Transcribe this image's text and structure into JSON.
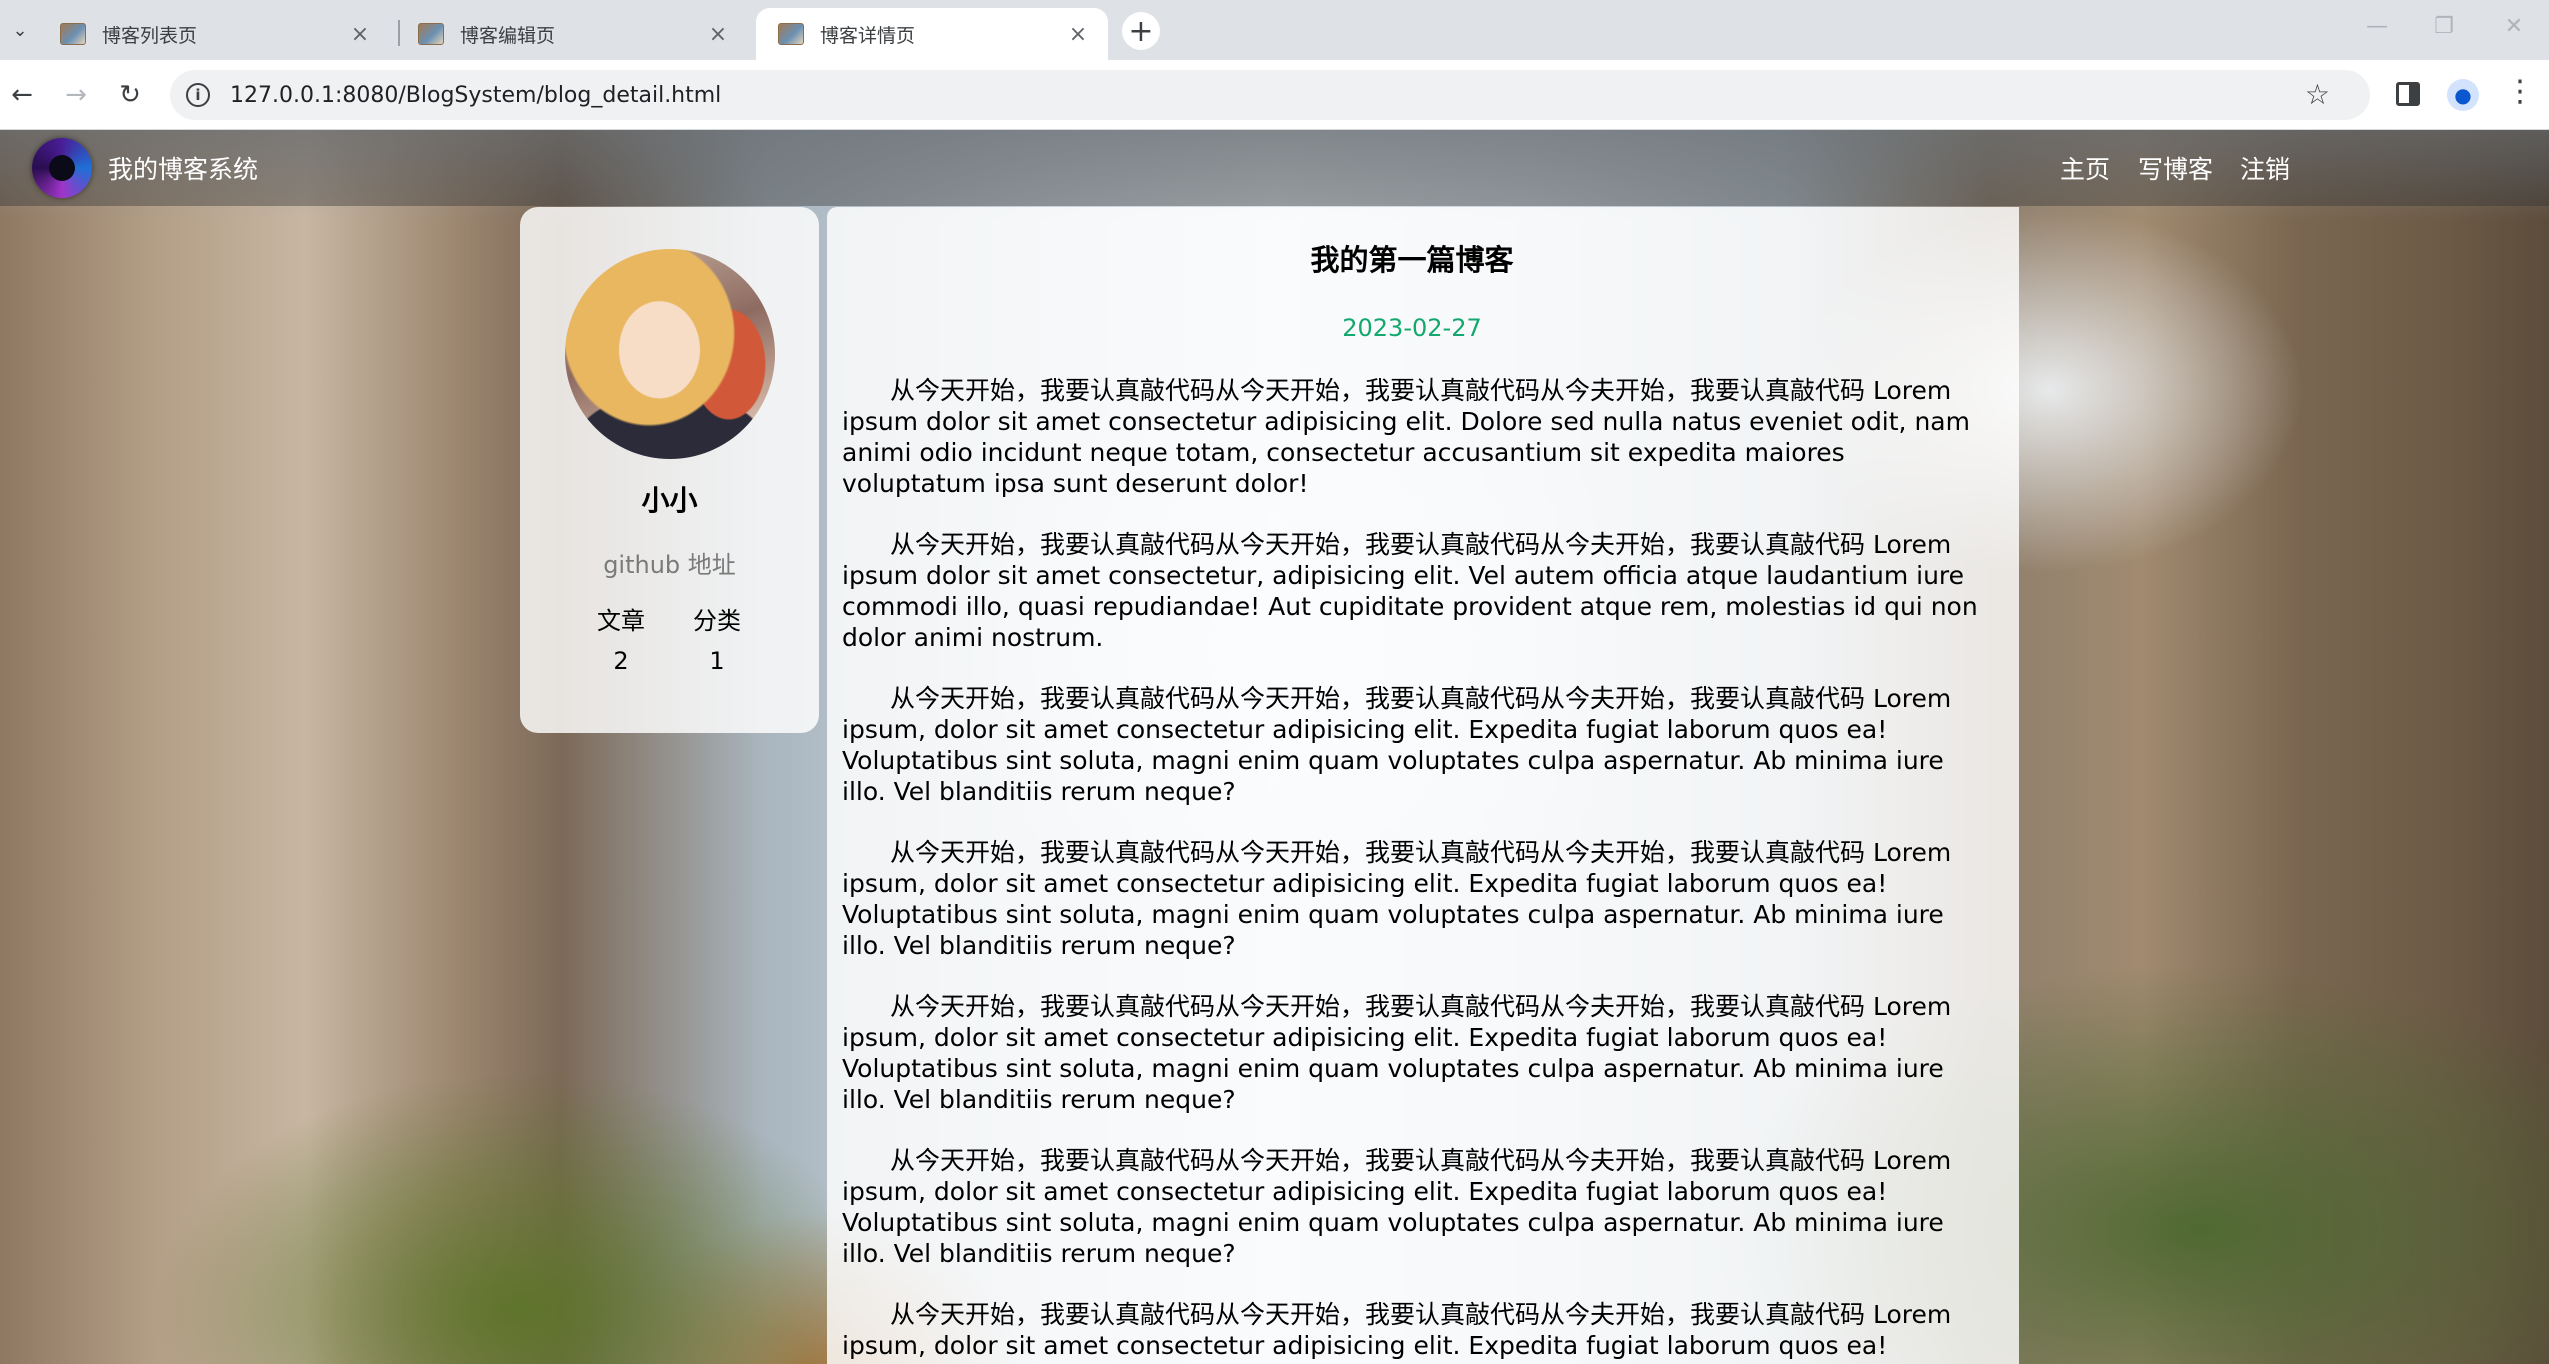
{
  "browser": {
    "tabs": [
      {
        "title": "博客列表页",
        "active": false
      },
      {
        "title": "博客编辑页",
        "active": false
      },
      {
        "title": "博客详情页",
        "active": true
      }
    ],
    "url": "127.0.0.1:8080/BlogSystem/blog_detail.html"
  },
  "site": {
    "title": "我的博客系统",
    "nav": {
      "home": "主页",
      "write": "写博客",
      "logout": "注销"
    }
  },
  "profile": {
    "name": "小小",
    "github": "github 地址",
    "stats": {
      "articles_label": "文章",
      "categories_label": "分类",
      "articles_value": "2",
      "categories_value": "1"
    }
  },
  "article": {
    "title": "我的第一篇博客",
    "date": "2023-02-27",
    "paragraphs": [
      "从今天开始，我要认真敲代码从今天开始，我要认真敲代码从今夫开始，我要认真敲代码 Lorem ipsum dolor sit amet consectetur adipisicing elit. Dolore sed nulla natus eveniet odit, nam animi odio incidunt neque totam, consectetur accusantium sit expedita maiores voluptatum ipsa sunt deserunt dolor!",
      "从今天开始，我要认真敲代码从今天开始，我要认真敲代码从今夫开始，我要认真敲代码 Lorem ipsum dolor sit amet consectetur, adipisicing elit. Vel autem officia atque laudantium iure commodi illo, quasi repudiandae! Aut cupiditate provident atque rem, molestias id qui non dolor animi nostrum.",
      "从今天开始，我要认真敲代码从今天开始，我要认真敲代码从今夫开始，我要认真敲代码 Lorem ipsum, dolor sit amet consectetur adipisicing elit. Expedita fugiat laborum quos ea! Voluptatibus sint soluta, magni enim quam voluptates culpa aspernatur. Ab minima iure illo. Vel blanditiis rerum neque?",
      "从今天开始，我要认真敲代码从今天开始，我要认真敲代码从今夫开始，我要认真敲代码 Lorem ipsum, dolor sit amet consectetur adipisicing elit. Expedita fugiat laborum quos ea! Voluptatibus sint soluta, magni enim quam voluptates culpa aspernatur. Ab minima iure illo. Vel blanditiis rerum neque?",
      "从今天开始，我要认真敲代码从今天开始，我要认真敲代码从今夫开始，我要认真敲代码 Lorem ipsum, dolor sit amet consectetur adipisicing elit. Expedita fugiat laborum quos ea! Voluptatibus sint soluta, magni enim quam voluptates culpa aspernatur. Ab minima iure illo. Vel blanditiis rerum neque?",
      "从今天开始，我要认真敲代码从今天开始，我要认真敲代码从今夫开始，我要认真敲代码 Lorem ipsum, dolor sit amet consectetur adipisicing elit. Expedita fugiat laborum quos ea! Voluptatibus sint soluta, magni enim quam voluptates culpa aspernatur. Ab minima iure illo. Vel blanditiis rerum neque?",
      "从今天开始，我要认真敲代码从今天开始，我要认真敲代码从今夫开始，我要认真敲代码 Lorem ipsum, dolor sit amet consectetur adipisicing elit. Expedita fugiat laborum quos ea! Voluptatibus"
    ]
  },
  "icons": {
    "tab_search": "chevron-down-icon",
    "close": "close-icon",
    "new_tab": "plus-icon",
    "back": "arrow-left-icon",
    "forward": "arrow-right-icon",
    "reload": "reload-icon",
    "site_info": "info-icon",
    "bookmark": "star-icon",
    "side_panel": "side-panel-icon",
    "profile": "profile-icon",
    "menu": "kebab-menu-icon"
  },
  "colors": {
    "date": "#13a86d",
    "nav_bg": "rgba(51,51,51,0.4)",
    "card_bg": "rgba(255,255,255,0.82)"
  }
}
